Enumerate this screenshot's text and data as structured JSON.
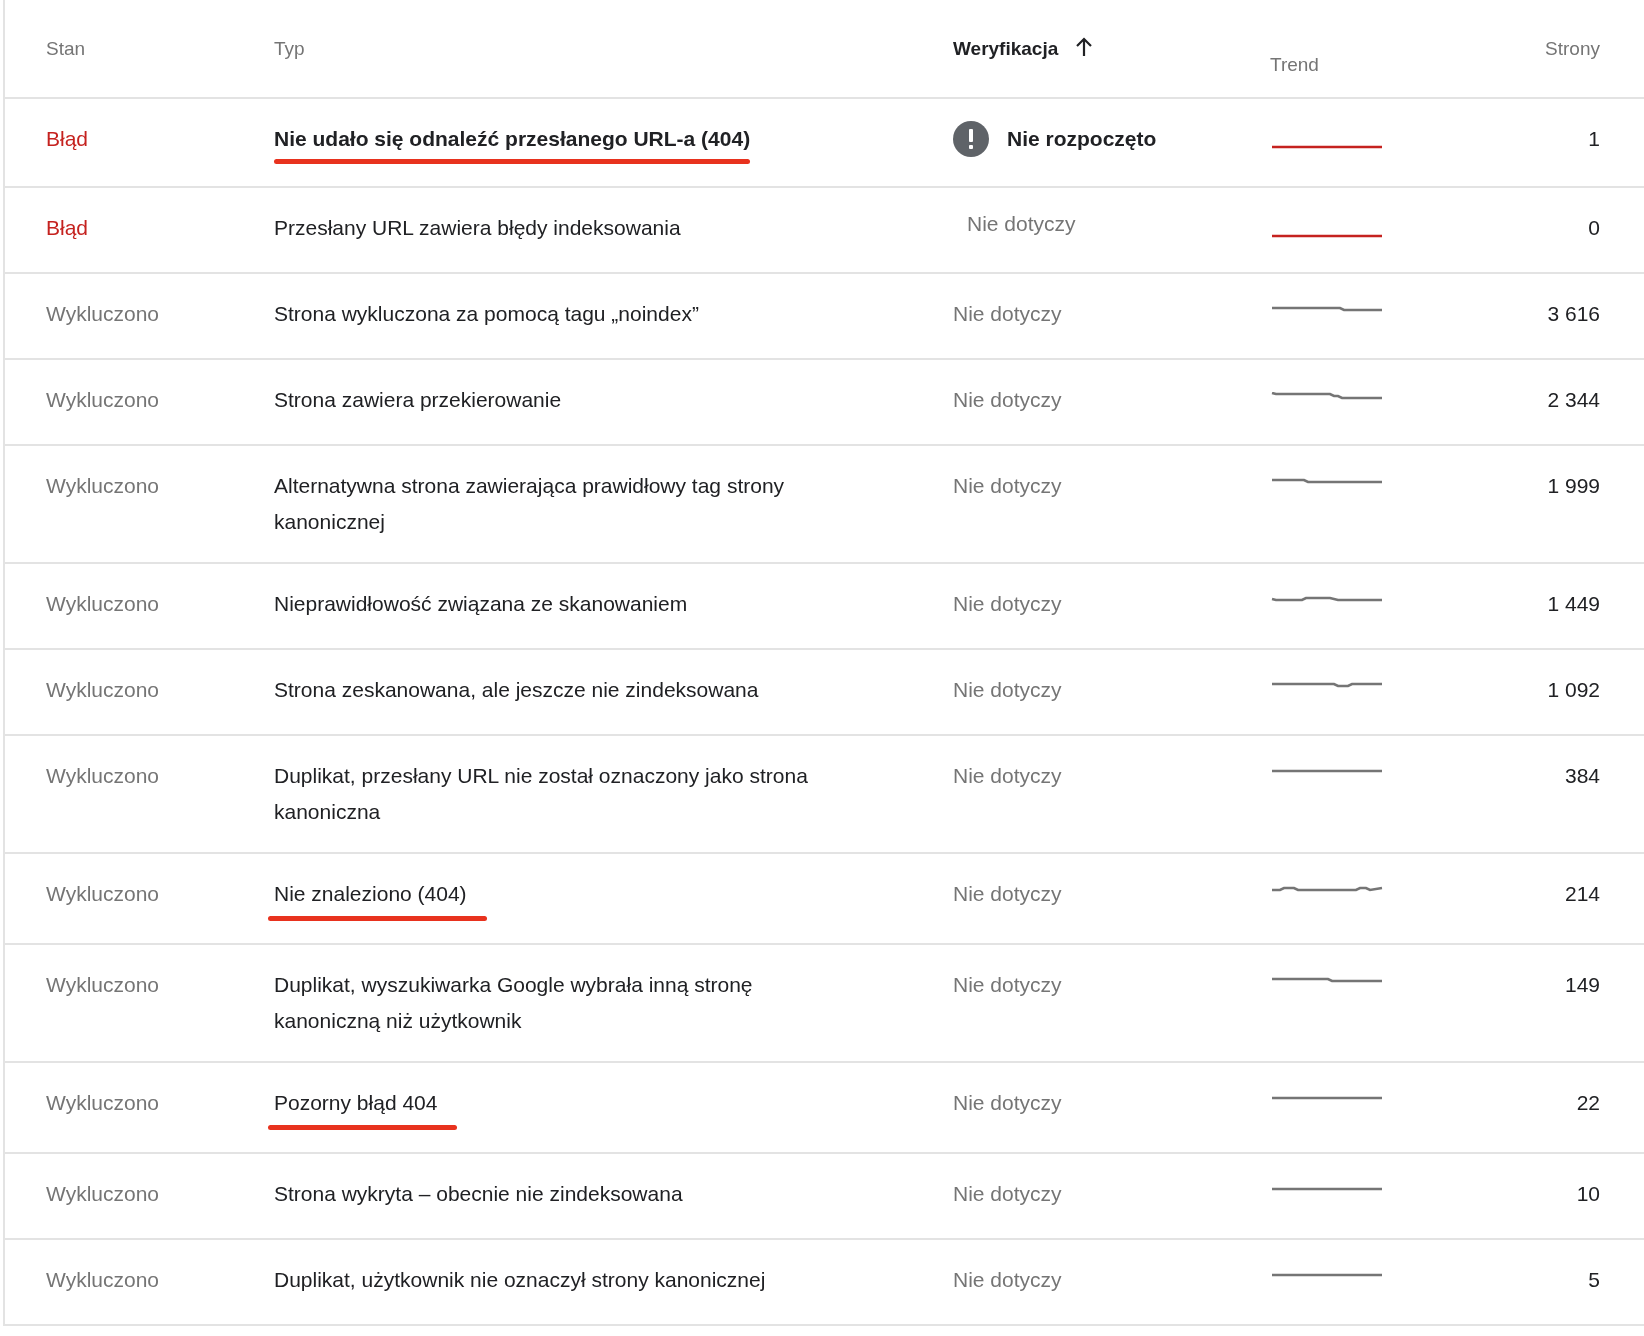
{
  "table": {
    "columns": [
      {
        "label": "Stan",
        "sorted": false
      },
      {
        "label": "Typ",
        "sorted": false
      },
      {
        "label": "Weryfikacja",
        "sorted": true
      },
      {
        "label": "Trend",
        "sorted": false
      },
      {
        "label": "Strony",
        "sorted": false
      }
    ],
    "rows": [
      {
        "status": {
          "label": "Błąd",
          "kind": "error"
        },
        "type": "Nie udało się odnaleźć przesłanego URL-a (404)",
        "underlined": true,
        "verification": {
          "label": "Nie rozpoczęto",
          "kind": "pending"
        },
        "pages": "1"
      },
      {
        "status": {
          "label": "Błąd",
          "kind": "error"
        },
        "type": "Przesłany URL zawiera błędy indeksowania",
        "underlined": false,
        "verification": {
          "label": "Nie dotyczy",
          "kind": "plain"
        },
        "pages": "0"
      },
      {
        "status": {
          "label": "Wykluczono",
          "kind": "excluded"
        },
        "type": "Strona wykluczona za pomocą tagu „noindex”",
        "underlined": false,
        "verification": {
          "label": "Nie dotyczy",
          "kind": "plain"
        },
        "pages": "3 616"
      },
      {
        "status": {
          "label": "Wykluczono",
          "kind": "excluded"
        },
        "type": "Strona zawiera przekierowanie",
        "underlined": false,
        "verification": {
          "label": "Nie dotyczy",
          "kind": "plain"
        },
        "pages": "2 344"
      },
      {
        "status": {
          "label": "Wykluczono",
          "kind": "excluded"
        },
        "type": "Alternatywna strona zawierająca prawidłowy tag strony kanonicznej",
        "underlined": false,
        "verification": {
          "label": "Nie dotyczy",
          "kind": "plain"
        },
        "pages": "1 999"
      },
      {
        "status": {
          "label": "Wykluczono",
          "kind": "excluded"
        },
        "type": "Nieprawidłowość związana ze skanowaniem",
        "underlined": false,
        "verification": {
          "label": "Nie dotyczy",
          "kind": "plain"
        },
        "pages": "1 449"
      },
      {
        "status": {
          "label": "Wykluczono",
          "kind": "excluded"
        },
        "type": "Strona zeskanowana, ale jeszcze nie zindeksowana",
        "underlined": false,
        "verification": {
          "label": "Nie dotyczy",
          "kind": "plain"
        },
        "pages": "1 092"
      },
      {
        "status": {
          "label": "Wykluczono",
          "kind": "excluded"
        },
        "type": "Duplikat, przesłany URL nie został oznaczony jako strona kanoniczna",
        "underlined": false,
        "verification": {
          "label": "Nie dotyczy",
          "kind": "plain"
        },
        "pages": "384"
      },
      {
        "status": {
          "label": "Wykluczono",
          "kind": "excluded"
        },
        "type": "Nie znaleziono (404)",
        "underlined": true,
        "verification": {
          "label": "Nie dotyczy",
          "kind": "plain"
        },
        "pages": "214"
      },
      {
        "status": {
          "label": "Wykluczono",
          "kind": "excluded"
        },
        "type": "Duplikat, wyszukiwarka Google wybrała inną stronę kanoniczną niż użytkownik",
        "underlined": false,
        "verification": {
          "label": "Nie dotyczy",
          "kind": "plain"
        },
        "pages": "149"
      },
      {
        "status": {
          "label": "Wykluczono",
          "kind": "excluded"
        },
        "type": "Pozorny błąd 404",
        "underlined": true,
        "verification": {
          "label": "Nie dotyczy",
          "kind": "plain"
        },
        "pages": "22"
      },
      {
        "status": {
          "label": "Wykluczono",
          "kind": "excluded"
        },
        "type": "Strona wykryta – obecnie nie zindeksowana",
        "underlined": false,
        "verification": {
          "label": "Nie dotyczy",
          "kind": "plain"
        },
        "pages": "10"
      },
      {
        "status": {
          "label": "Wykluczono",
          "kind": "excluded"
        },
        "type": "Duplikat, użytkownik nie oznaczył strony kanonicznej",
        "underlined": false,
        "verification": {
          "label": "Nie dotyczy",
          "kind": "plain"
        },
        "pages": "5"
      }
    ]
  }
}
